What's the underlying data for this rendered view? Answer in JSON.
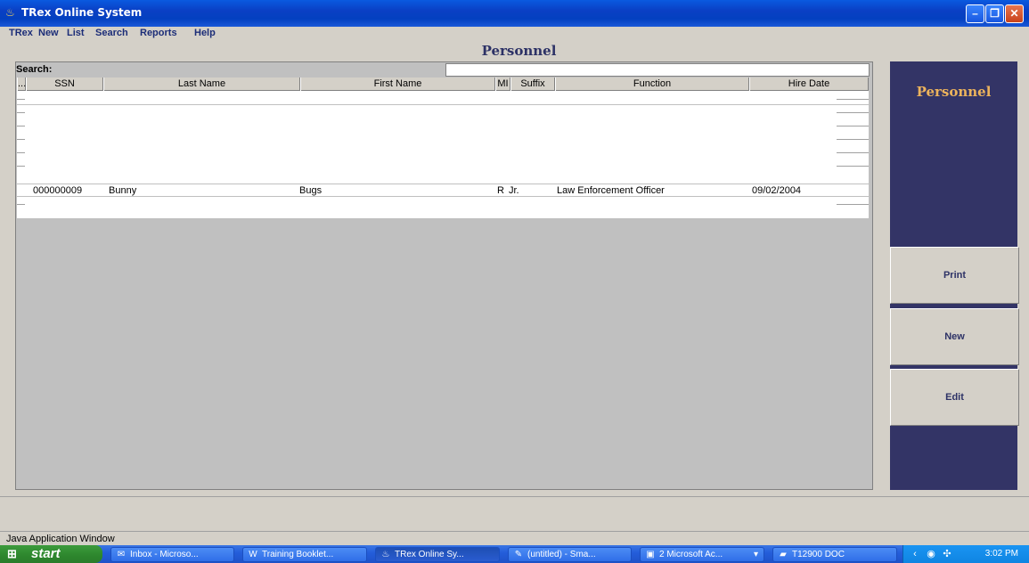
{
  "window": {
    "title": "TRex Online System"
  },
  "menu": [
    {
      "label": "TRex",
      "mnemonic": "T"
    },
    {
      "label": "New",
      "mnemonic": "N"
    },
    {
      "label": "List",
      "mnemonic": "L"
    },
    {
      "label": "Search",
      "mnemonic": "S"
    },
    {
      "label": "Reports",
      "mnemonic": "R"
    },
    {
      "label": "Help",
      "mnemonic": "H"
    }
  ],
  "page": {
    "title": "Personnel"
  },
  "search": {
    "label": "Search:",
    "value": ""
  },
  "table": {
    "columns": [
      "...",
      "SSN",
      "Last Name",
      "First Name",
      "MI",
      "Suffix",
      "Function",
      "Hire Date"
    ],
    "rows": [
      {
        "ssn": "000000009",
        "last_name": "Bunny",
        "first_name": "Bugs",
        "mi": "R",
        "suffix": "Jr.",
        "function": "Law Enforcement Officer",
        "hire_date": "09/02/2004"
      }
    ]
  },
  "sidebar": {
    "title": "Personnel",
    "buttons": {
      "print": "Print",
      "new": "New",
      "edit": "Edit"
    }
  },
  "status": {
    "text": "Java Application Window"
  },
  "taskbar": {
    "start": "start",
    "tasks": [
      {
        "label": "Inbox - Microso...",
        "icon": "outlook-icon"
      },
      {
        "label": "Training Booklet...",
        "icon": "word-icon"
      },
      {
        "label": "TRex Online Sy...",
        "icon": "java-icon"
      },
      {
        "label": "(untitled) - Sma...",
        "icon": "snagit-icon"
      },
      {
        "label": "2 Microsoft Ac...",
        "icon": "access-icon"
      },
      {
        "label": "T12900 DOC",
        "icon": "folder-icon"
      }
    ],
    "clock": "3:02 PM"
  },
  "colors": {
    "title_blue": "#2d3266",
    "side_panel": "#333466",
    "side_title": "#ecb35c"
  }
}
